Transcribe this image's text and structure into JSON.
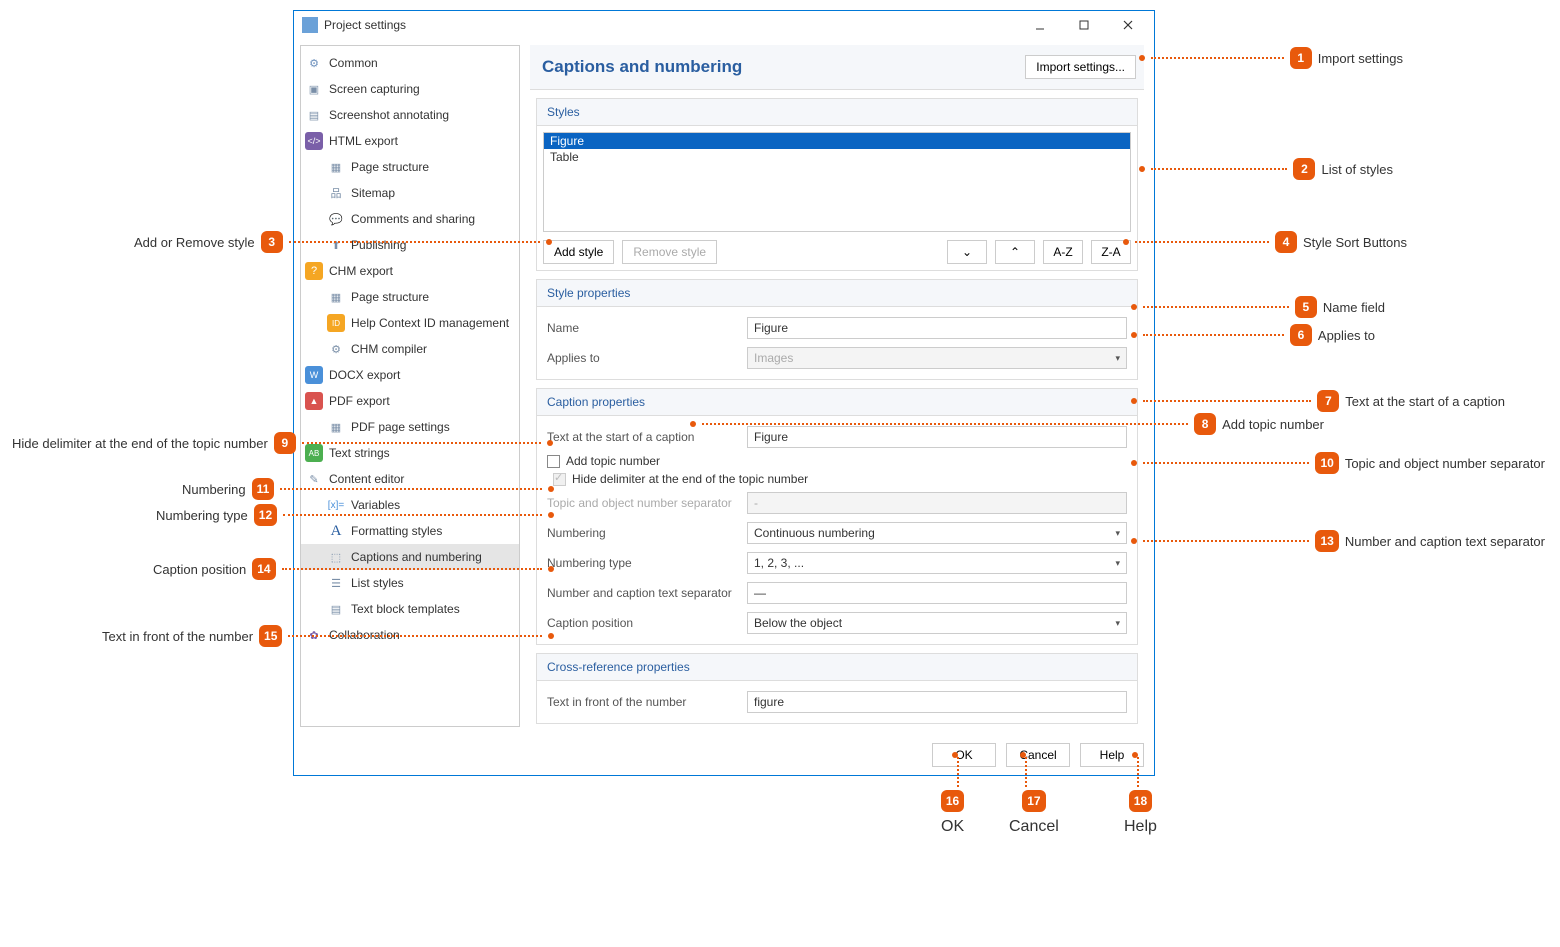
{
  "titlebar": {
    "title": "Project settings"
  },
  "sidebar": {
    "items": [
      {
        "label": "Common"
      },
      {
        "label": "Screen capturing"
      },
      {
        "label": "Screenshot annotating"
      },
      {
        "label": "HTML export"
      },
      {
        "label": "Page structure"
      },
      {
        "label": "Sitemap"
      },
      {
        "label": "Comments and sharing"
      },
      {
        "label": "Publishing"
      },
      {
        "label": "CHM export"
      },
      {
        "label": "Page structure"
      },
      {
        "label": "Help Context ID management"
      },
      {
        "label": "CHM compiler"
      },
      {
        "label": "DOCX export"
      },
      {
        "label": "PDF export"
      },
      {
        "label": "PDF page settings"
      },
      {
        "label": "Text strings"
      },
      {
        "label": "Content editor"
      },
      {
        "label": "Variables"
      },
      {
        "label": "Formatting styles"
      },
      {
        "label": "Captions and numbering"
      },
      {
        "label": "List styles"
      },
      {
        "label": "Text block templates"
      },
      {
        "label": "Collaboration"
      }
    ]
  },
  "content": {
    "title": "Captions and numbering",
    "import_btn": "Import settings...",
    "styles": {
      "heading": "Styles",
      "items": [
        "Figure",
        "Table"
      ],
      "add": "Add style",
      "remove": "Remove style",
      "sort_az": "A-Z",
      "sort_za": "Z-A"
    },
    "style_props": {
      "heading": "Style properties",
      "name_lbl": "Name",
      "name_val": "Figure",
      "applies_lbl": "Applies to",
      "applies_val": "Images"
    },
    "caption_props": {
      "heading": "Caption properties",
      "start_lbl": "Text at the start of a caption",
      "start_val": "Figure",
      "add_topic": "Add topic number",
      "hide_delim": "Hide delimiter at the end of the topic number",
      "sep_lbl": "Topic and object number separator",
      "sep_val": "-",
      "numbering_lbl": "Numbering",
      "numbering_val": "Continuous numbering",
      "numtype_lbl": "Numbering type",
      "numtype_val": "1, 2, 3, ...",
      "numcap_lbl": "Number and caption text separator",
      "numcap_val": "—",
      "pos_lbl": "Caption position",
      "pos_val": "Below the object"
    },
    "xref": {
      "heading": "Cross-reference properties",
      "front_lbl": "Text in front of the number",
      "front_val": "figure"
    }
  },
  "footer": {
    "ok": "OK",
    "cancel": "Cancel",
    "help": "Help"
  },
  "callouts": {
    "c1": "Import settings",
    "c2": "List of styles",
    "c3": "Add or Remove style",
    "c4": "Style Sort Buttons",
    "c5": "Name field",
    "c6": "Applies to",
    "c7": "Text at the start of a caption",
    "c8": "Add topic number",
    "c9": "Hide delimiter at the end of the topic number",
    "c10": "Topic and object number separator",
    "c11": "Numbering",
    "c12": "Numbering type",
    "c13": "Number and caption text separator",
    "c14": "Caption position",
    "c15": "Text in front of the number",
    "c16": "OK",
    "c17": "Cancel",
    "c18": "Help"
  }
}
